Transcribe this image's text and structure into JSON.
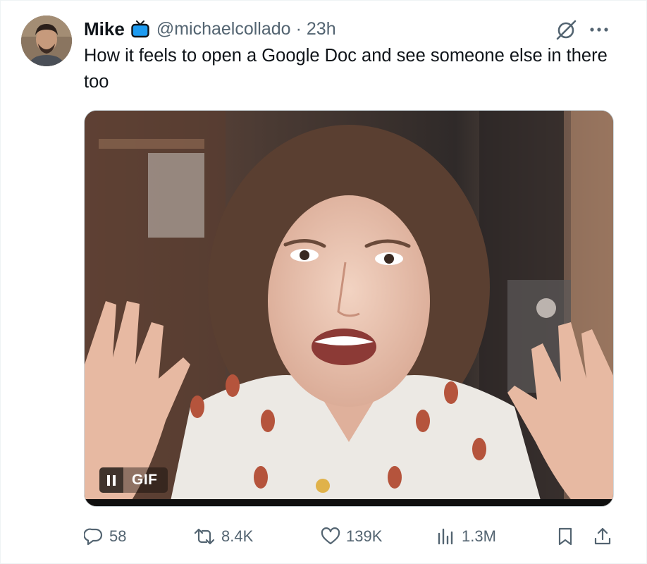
{
  "user": {
    "display_name": "Mike",
    "handle": "@michaelcollado",
    "separator": "·",
    "time": "23h",
    "badge_icon": "tv-icon",
    "badge_color": "#1d9bf0"
  },
  "tweet": {
    "text": "How it feels to open a Google Doc and see someone else in there too"
  },
  "media": {
    "type": "gif",
    "gif_label": "GIF",
    "pause_icon": "pause-icon"
  },
  "actions": {
    "reply": {
      "icon": "reply-icon",
      "count": "58"
    },
    "retweet": {
      "icon": "retweet-icon",
      "count": "8.4K"
    },
    "like": {
      "icon": "heart-icon",
      "count": "139K"
    },
    "views": {
      "icon": "views-icon",
      "count": "1.3M"
    },
    "bookmark": {
      "icon": "bookmark-icon"
    },
    "share": {
      "icon": "share-icon"
    }
  },
  "colors": {
    "text_primary": "#0f1419",
    "text_secondary": "#536471",
    "border": "#eff3f4"
  }
}
